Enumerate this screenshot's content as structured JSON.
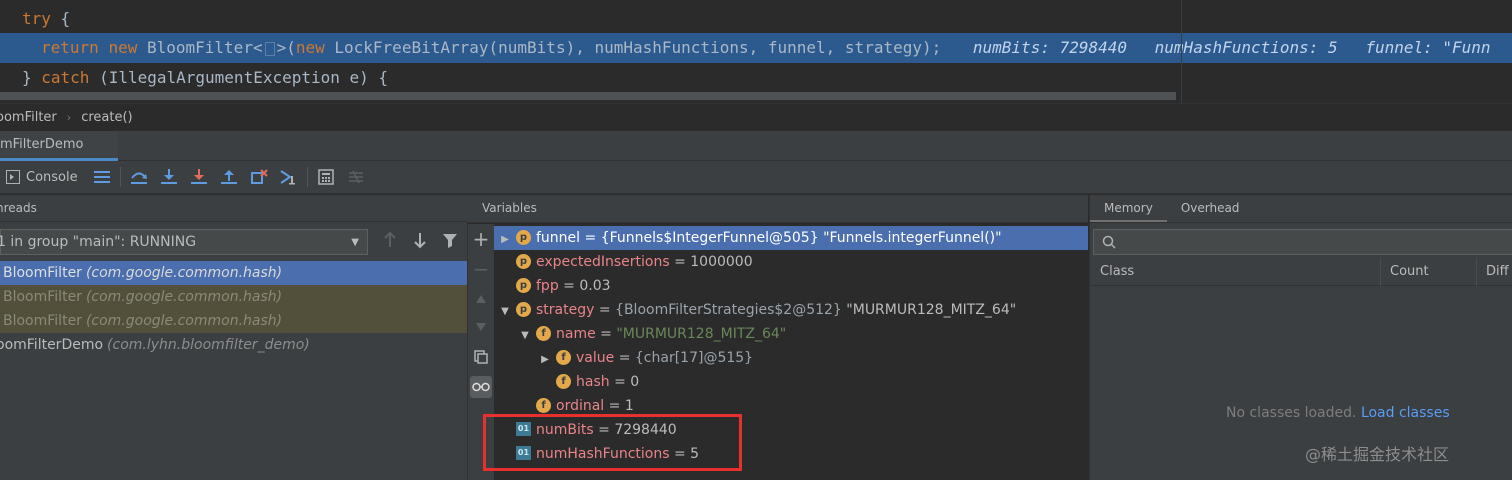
{
  "editor": {
    "line1": {
      "kw_try": "try",
      "brace": " {"
    },
    "line2": {
      "kw_return": "return",
      "kw_new": "new",
      "text_a": "BloomFilter<",
      "text_b": ">(",
      "kw_new2": "new",
      "text_c": " LockFreeBitArray(numBits), numHashFunctions, funnel, strategy);",
      "hint1": "numBits: 7298440",
      "hint2": "numHashFunctions: 5",
      "hint3": "funnel: \"Funn"
    },
    "line3": {
      "brace": "} ",
      "kw_catch": "catch",
      "rest": " (IllegalArgumentException e) {"
    }
  },
  "breadcrumb": {
    "class": "oomFilter",
    "method": "create()"
  },
  "debug_tab": {
    "label": "omFilterDemo"
  },
  "toolbar": {
    "console_label": "Console"
  },
  "threads": {
    "header": "hreads",
    "selected_thread": "1 in group \"main\": RUNNING",
    "frames": [
      {
        "method": "BloomFilter",
        "pkg": "(com.google.common.hash)"
      },
      {
        "method": "BloomFilter",
        "pkg": "(com.google.common.hash)"
      },
      {
        "method": "BloomFilter",
        "pkg": "(com.google.common.hash)"
      },
      {
        "method": "oomFilterDemo",
        "pkg": "(com.lyhn.bloomfilter_demo)"
      }
    ]
  },
  "variables": {
    "header": "Variables",
    "rows": [
      {
        "badge": "p",
        "name": "funnel",
        "eq": " = ",
        "value": "{Funnels$IntegerFunnel@505} \"Funnels.integerFunnel()\""
      },
      {
        "badge": "p",
        "name": "expectedInsertions",
        "eq": " = ",
        "value": "1000000"
      },
      {
        "badge": "p",
        "name": "fpp",
        "eq": " = ",
        "value": "0.03"
      },
      {
        "badge": "p",
        "name": "strategy",
        "eq": " = ",
        "value_gray": "{BloomFilterStrategies$2@512}",
        "value": " \"MURMUR128_MITZ_64\""
      },
      {
        "badge": "f",
        "name": "name",
        "eq": " = ",
        "value": "\"MURMUR128_MITZ_64\""
      },
      {
        "badge": "f",
        "name": "value",
        "eq": " = ",
        "value": "{char[17]@515}"
      },
      {
        "badge": "f",
        "name": "hash",
        "eq": " = ",
        "value": "0"
      },
      {
        "badge": "f",
        "name": "ordinal",
        "eq": " = ",
        "value": "1"
      },
      {
        "badge": "01",
        "name": "numBits",
        "eq": " = ",
        "value": "7298440"
      },
      {
        "badge": "01",
        "name": "numHashFunctions",
        "eq": " = ",
        "value": "5"
      }
    ]
  },
  "memory": {
    "tabs": [
      "Memory",
      "Overhead"
    ],
    "columns": {
      "class": "Class",
      "count": "Count",
      "diff": "Diff"
    },
    "empty_text": "No classes loaded.",
    "load_link": "Load classes"
  },
  "watermark": "@稀土掘金技术社区",
  "colors": {
    "selection": "#4b6eaf",
    "highlight_box": "#e8312f",
    "link": "#589df6"
  }
}
